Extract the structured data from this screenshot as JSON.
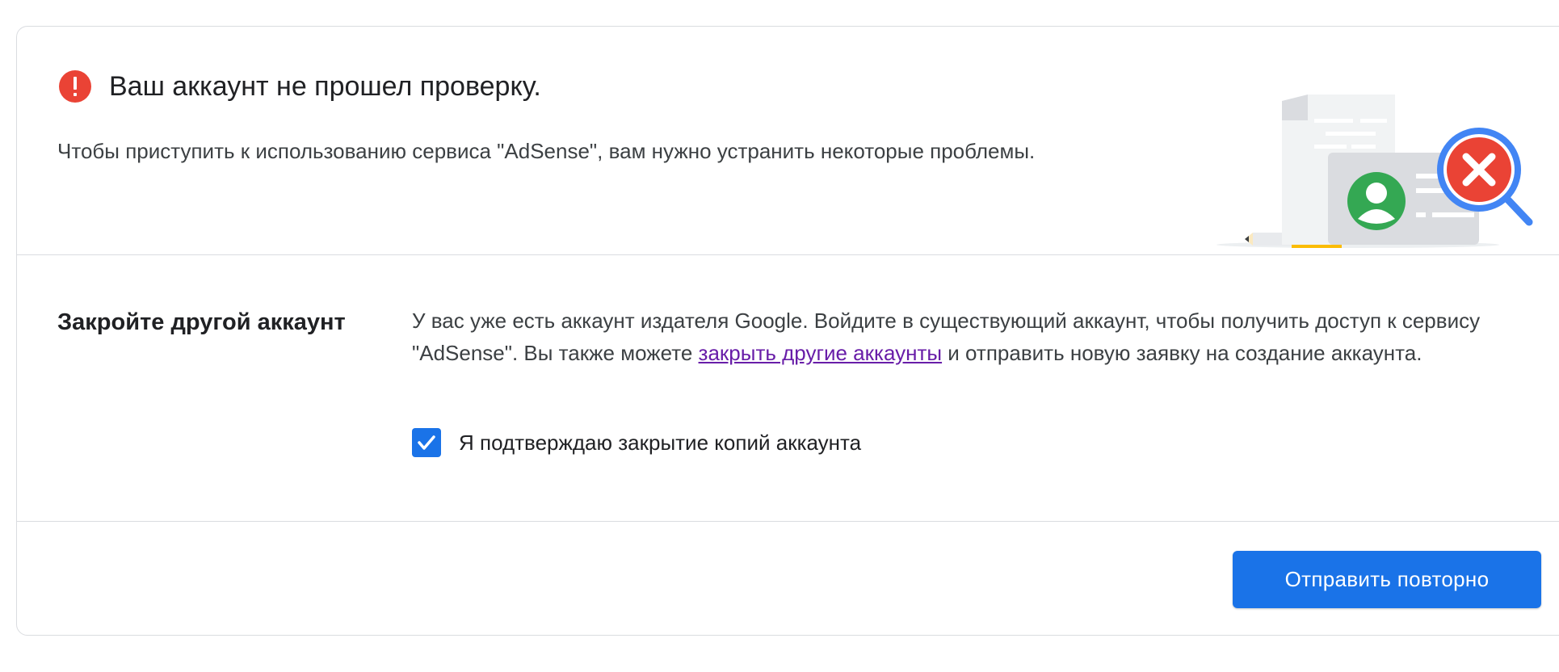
{
  "status": {
    "icon": "error-icon",
    "title": "Ваш аккаунт не прошел проверку.",
    "subtitle": "Чтобы приступить к использованию сервиса \"AdSense\", вам нужно устранить некоторые проблемы.",
    "illustration_icon": "account-rejected-illustration"
  },
  "issue": {
    "heading": "Закройте другой аккаунт",
    "text_before_link": "У вас уже есть аккаунт издателя Google. Войдите в существующий аккаунт, чтобы получить доступ к сервису \"AdSense\". Вы также можете ",
    "link_text": "закрыть другие аккаунты",
    "text_after_link": " и отправить новую заявку на создание аккаунта.",
    "confirm_label": "Я подтверждаю закрытие копий аккаунта",
    "confirm_checked": true
  },
  "actions": {
    "resubmit_label": "Отправить повторно"
  },
  "colors": {
    "accent": "#1a73e8",
    "error": "#ea4335",
    "link_visited": "#681da8"
  }
}
